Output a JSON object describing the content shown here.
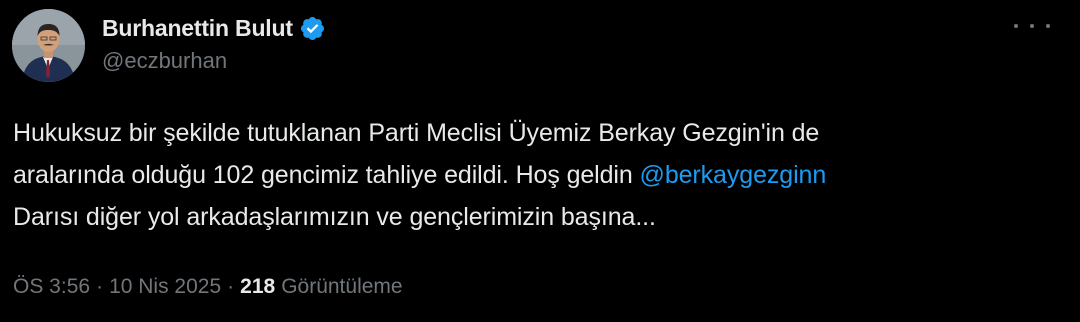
{
  "author": {
    "name": "Burhanettin Bulut",
    "handle": "@eczburhan",
    "verified_icon": "verified-badge-icon"
  },
  "more_icon": "more-options-icon",
  "tweet": {
    "line1": "Hukuksuz bir şekilde tutuklanan Parti Meclisi Üyemiz Berkay Gezgin'in de",
    "line2_text": "aralarında olduğu 102 gencimiz tahliye edildi. Hoş geldin ",
    "line2_mention": "@berkaygezginn",
    "line3": "Darısı diğer yol arkadaşlarımızın ve gençlerimizin başına..."
  },
  "meta": {
    "time": "ÖS 3:56",
    "separator": "·",
    "date": "10 Nis 2025",
    "views_count": "218",
    "views_label": "Görüntüleme"
  },
  "colors": {
    "background": "#000000",
    "text": "#e7e9ea",
    "secondary": "#71767b",
    "link": "#1d9bf0"
  }
}
